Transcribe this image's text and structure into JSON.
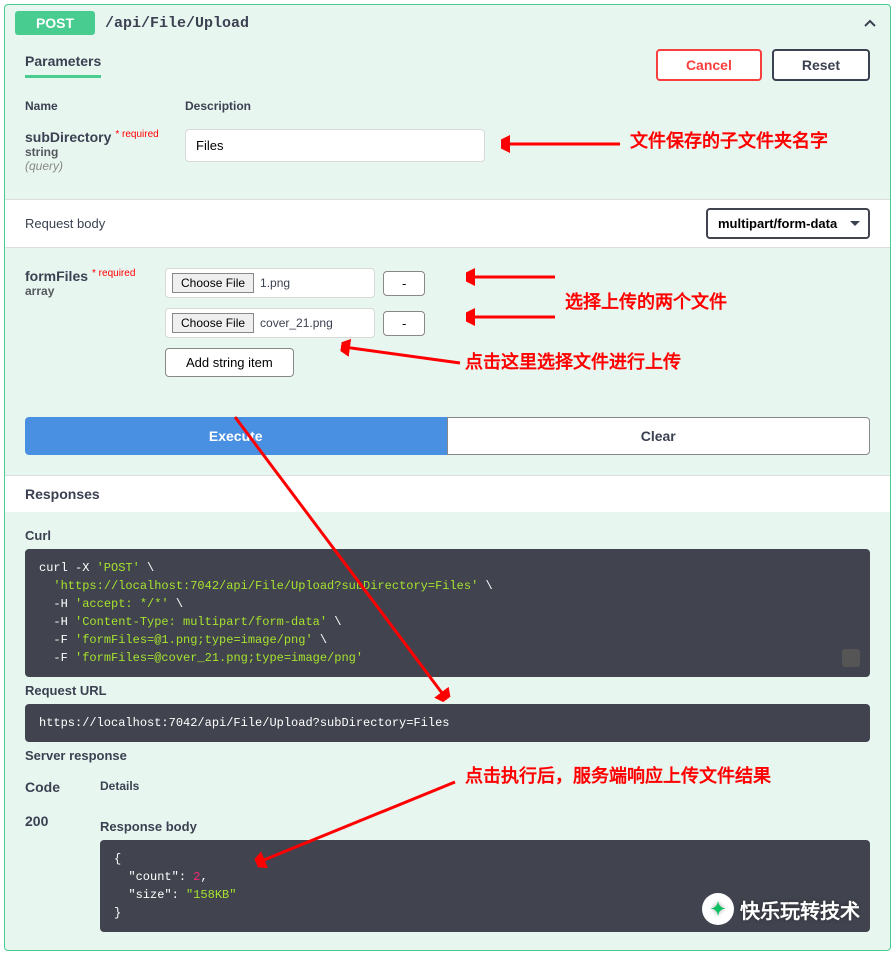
{
  "header": {
    "method": "POST",
    "path": "/api/File/Upload"
  },
  "params": {
    "title": "Parameters",
    "cancel": "Cancel",
    "reset": "Reset",
    "name_header": "Name",
    "desc_header": "Description",
    "subDirectory": {
      "name": "subDirectory",
      "required": "* required",
      "type": "string",
      "in": "(query)",
      "value": "Files"
    }
  },
  "annotations": {
    "a1": "文件保存的子文件夹名字",
    "a2": "选择上传的两个文件",
    "a3": "点击这里选择文件进行上传",
    "a4": "点击执行后，服务端响应上传文件结果"
  },
  "request_body": {
    "title": "Request body",
    "content_type": "multipart/form-data",
    "formFiles": {
      "name": "formFiles",
      "required": "* required",
      "type": "array",
      "choose": "Choose File",
      "files": [
        "1.png",
        "cover_21.png"
      ],
      "remove": "-",
      "add": "Add string item"
    }
  },
  "actions": {
    "execute": "Execute",
    "clear": "Clear"
  },
  "responses": {
    "title": "Responses",
    "curl_label": "Curl",
    "curl_prefix": "curl -X ",
    "curl_method": "'POST'",
    "curl_url": "'https://localhost:7042/api/File/Upload?subDirectory=Files'",
    "curl_h1": "-H ",
    "curl_h1v": "'accept: */*'",
    "curl_h2": "-H ",
    "curl_h2v": "'Content-Type: multipart/form-data'",
    "curl_f1": "-F ",
    "curl_f1v": "'formFiles=@1.png;type=image/png'",
    "curl_f2": "-F ",
    "curl_f2v": "'formFiles=@cover_21.png;type=image/png'",
    "request_url_label": "Request URL",
    "request_url": "https://localhost:7042/api/File/Upload?subDirectory=Files",
    "server_response": "Server response",
    "code_header": "Code",
    "details_header": "Details",
    "code": "200",
    "response_body_label": "Response body",
    "body_open": "{",
    "body_count_k": "\"count\"",
    "body_count_v": "2",
    "body_size_k": "\"size\"",
    "body_size_v": "\"158KB\"",
    "body_close": "}"
  },
  "watermark": "快乐玩转技术"
}
